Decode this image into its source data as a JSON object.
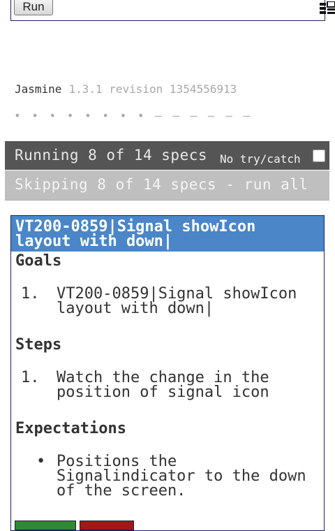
{
  "toolbar": {
    "run_label": "Run",
    "menu_icon": "grid-menu-icon"
  },
  "jasmine": {
    "name": "Jasmine",
    "version": "1.3.1 revision 1354556913",
    "progress": "• • • • • • • • – – – – – –"
  },
  "running": {
    "text": "Running 8 of 14 specs",
    "notry_label": "No try/catch"
  },
  "skipping": {
    "text": "Skipping 8 of 14 specs - run all"
  },
  "spec": {
    "title": "VT200-0859|Signal showIcon layout with down|",
    "goals_heading": "Goals",
    "goals": [
      {
        "num": "1.",
        "text": "VT200-0859|Signal showIcon layout with down|"
      }
    ],
    "steps_heading": "Steps",
    "steps": [
      {
        "num": "1.",
        "text": "Watch the change in the position of signal icon"
      }
    ],
    "expectations_heading": "Expectations",
    "expectations": [
      {
        "bullet": "•",
        "text": "Positions the Signalindicator to the down of the screen."
      }
    ]
  }
}
